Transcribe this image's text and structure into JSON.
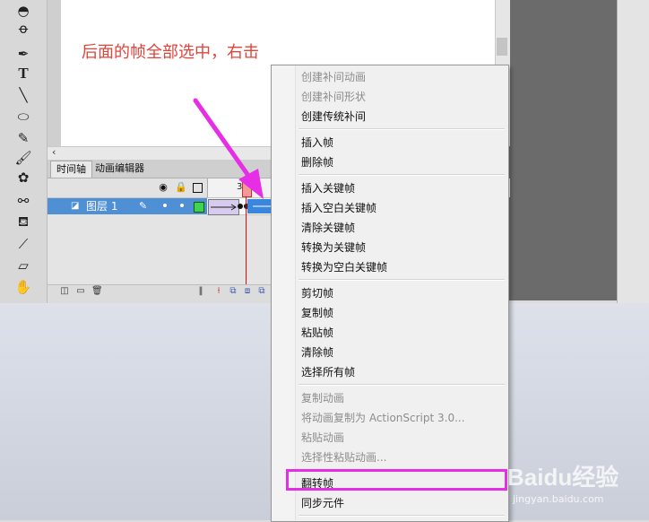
{
  "stage": {
    "hint_text": "后面的帧全部选中，右击"
  },
  "tabs": {
    "timeline": "时间轴",
    "motion_editor": "动画编辑器"
  },
  "timeline": {
    "frame_ruler_number": "30",
    "layer_name": "图层 1",
    "layer_color": "#3fd34f"
  },
  "toolbar": {
    "icons": [
      "3d-rotation-icon",
      "lasso-icon",
      "pen-icon",
      "text-icon",
      "line-icon",
      "oval-icon",
      "pencil-icon",
      "brush-icon",
      "deco-icon",
      "bone-icon",
      "paint-bucket-icon",
      "eyedropper-icon",
      "eraser-icon",
      "hand-icon"
    ],
    "text_tool": "T"
  },
  "context_menu": {
    "items": [
      {
        "label": "创建补间动画",
        "enabled": false
      },
      {
        "label": "创建补间形状",
        "enabled": false
      },
      {
        "label": "创建传统补间",
        "enabled": true
      },
      {
        "label": "插入帧",
        "enabled": true
      },
      {
        "label": "删除帧",
        "enabled": true
      },
      {
        "label": "插入关键帧",
        "enabled": true
      },
      {
        "label": "插入空白关键帧",
        "enabled": true
      },
      {
        "label": "清除关键帧",
        "enabled": true
      },
      {
        "label": "转换为关键帧",
        "enabled": true
      },
      {
        "label": "转换为空白关键帧",
        "enabled": true
      },
      {
        "label": "剪切帧",
        "enabled": true
      },
      {
        "label": "复制帧",
        "enabled": true
      },
      {
        "label": "粘贴帧",
        "enabled": true
      },
      {
        "label": "清除帧",
        "enabled": true
      },
      {
        "label": "选择所有帧",
        "enabled": true
      },
      {
        "label": "复制动画",
        "enabled": false
      },
      {
        "label": "将动画复制为 ActionScript 3.0...",
        "enabled": false
      },
      {
        "label": "粘贴动画",
        "enabled": false
      },
      {
        "label": "选择性粘贴动画...",
        "enabled": false
      },
      {
        "label": "翻转帧",
        "enabled": true,
        "highlighted": true
      },
      {
        "label": "同步元件",
        "enabled": true
      }
    ]
  },
  "colors": {
    "arrow": "#e62ee6",
    "highlight_box": "#e62ee6",
    "hint_text": "#e0443a",
    "layer_row": "#4f8fd4"
  },
  "watermark": {
    "brand": "Baidu经验",
    "url": "jingyan.baidu.com"
  }
}
